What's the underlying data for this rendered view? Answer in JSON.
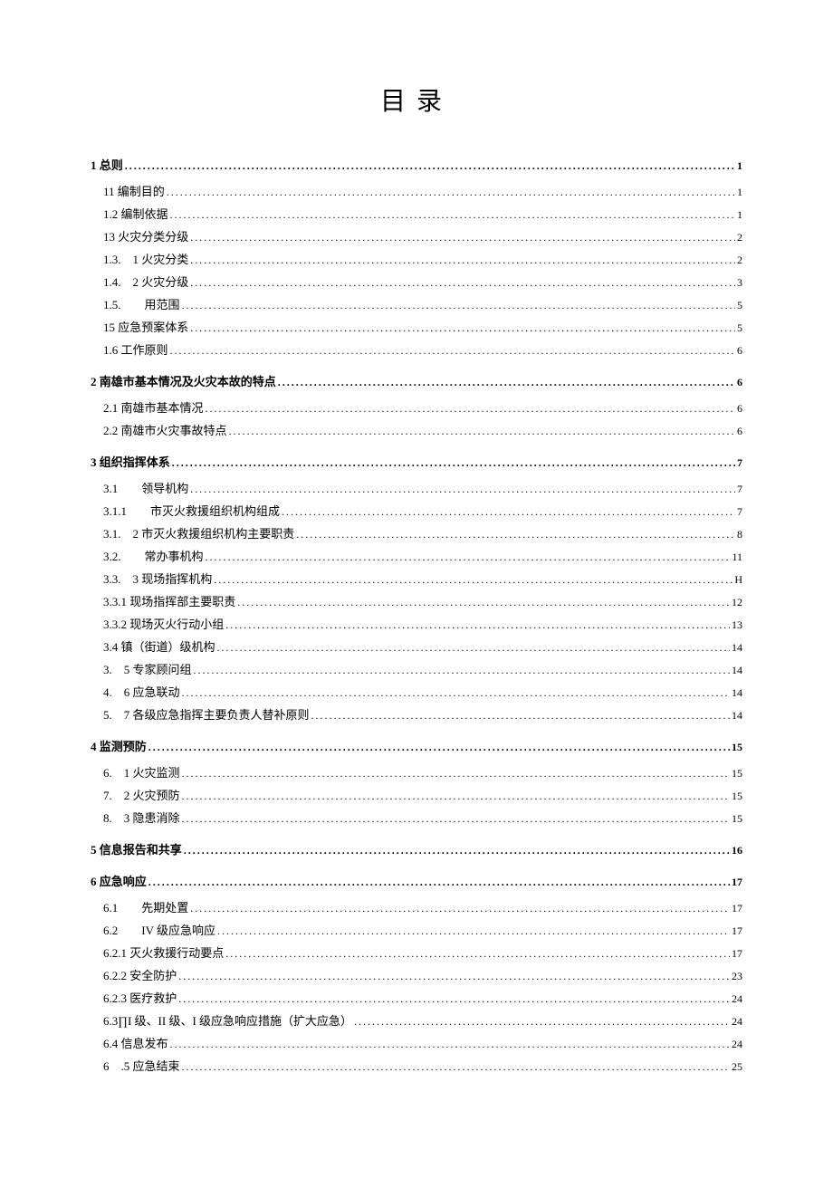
{
  "title": "目录",
  "toc": [
    {
      "label": "1 总则",
      "page": "1",
      "bold": true,
      "indent": 0,
      "gap": true
    },
    {
      "label": "11 编制目的",
      "page": "1",
      "bold": false,
      "indent": 1
    },
    {
      "label": "1.2 编制依据",
      "page": "1",
      "bold": false,
      "indent": 1
    },
    {
      "label": "13 火灾分类分级",
      "page": "2",
      "bold": false,
      "indent": 1
    },
    {
      "label": "1.3.　1 火灾分类",
      "page": "2",
      "bold": false,
      "indent": 2
    },
    {
      "label": "1.4.　2 火灾分级",
      "page": "3",
      "bold": false,
      "indent": 2
    },
    {
      "label": "1.5.　　用范围",
      "page": "5",
      "bold": false,
      "indent": 2
    },
    {
      "label": "15 应急预案体系",
      "page": "5",
      "bold": false,
      "indent": 1
    },
    {
      "label": "1.6 工作原则",
      "page": "6",
      "bold": false,
      "indent": 1
    },
    {
      "label": "2 南雄市基本情况及火灾本故的特点",
      "page": "6",
      "bold": true,
      "indent": 0,
      "gap": true
    },
    {
      "label": "2.1 南雄市基本情况",
      "page": "6",
      "bold": false,
      "indent": 1
    },
    {
      "label": "2.2 南雄市火灾事故特点",
      "page": "6",
      "bold": false,
      "indent": 1
    },
    {
      "label": "3 组织指挥体系",
      "page": "7",
      "bold": true,
      "indent": 0,
      "gap": true
    },
    {
      "label": "3.1　　领导机构",
      "page": "7",
      "bold": false,
      "indent": 1
    },
    {
      "label": "3.1.1　　市灭火救援组织机构组成",
      "page": "7",
      "bold": false,
      "indent": 1
    },
    {
      "label": "3.1.　2 市灭火救援组织机构主要职责",
      "page": "8",
      "bold": false,
      "indent": 1
    },
    {
      "label": "3.2.　　常办事机构",
      "page": "11",
      "bold": false,
      "indent": 1
    },
    {
      "label": "3.3.　3 现场指挥机构",
      "page": "H",
      "bold": false,
      "indent": 1
    },
    {
      "label": "3.3.1 现场指挥部主要职责",
      "page": "12",
      "bold": false,
      "indent": 1
    },
    {
      "label": "3.3.2 现场灭火行动小组",
      "page": "13",
      "bold": false,
      "indent": 1
    },
    {
      "label": "3.4 镇（街道）级机构",
      "page": "14",
      "bold": false,
      "indent": 1
    },
    {
      "label": "3.　5 专家顾问组",
      "page": "14",
      "bold": false,
      "indent": 1
    },
    {
      "label": "4.　6 应急联动",
      "page": "14",
      "bold": false,
      "indent": 1
    },
    {
      "label": "5.　7 各级应急指挥主要负责人替补原则",
      "page": "14",
      "bold": false,
      "indent": 1
    },
    {
      "label": "4 监测预防",
      "page": "15",
      "bold": true,
      "indent": 0,
      "gap": true
    },
    {
      "label": "6.　1 火灾监测",
      "page": "15",
      "bold": false,
      "indent": 1
    },
    {
      "label": "7.　2 火灾预防",
      "page": "15",
      "bold": false,
      "indent": 1
    },
    {
      "label": "8.　3 隐患消除",
      "page": "15",
      "bold": false,
      "indent": 1
    },
    {
      "label": "5 信息报告和共享",
      "page": "16",
      "bold": true,
      "indent": 0,
      "gap": true
    },
    {
      "label": "6 应急响应",
      "page": "17",
      "bold": true,
      "indent": 0,
      "gap": true
    },
    {
      "label": "6.1　　先期处置",
      "page": "17",
      "bold": false,
      "indent": 1
    },
    {
      "label": "6.2　　IV 级应急响应",
      "page": "17",
      "bold": false,
      "indent": 1
    },
    {
      "label": "6.2.1 灭火救援行动要点",
      "page": "17",
      "bold": false,
      "indent": 1
    },
    {
      "label": "6.2.2 安全防护",
      "page": "23",
      "bold": false,
      "indent": 1
    },
    {
      "label": "6.2.3 医疗救护",
      "page": "24",
      "bold": false,
      "indent": 1
    },
    {
      "label": "6.3∏I 级、II 级、I 级应急响应措施（扩大应急）",
      "page": "24",
      "bold": false,
      "indent": 1
    },
    {
      "label": "6.4 信息发布",
      "page": "24",
      "bold": false,
      "indent": 1
    },
    {
      "label": "6　.5 应急结束",
      "page": "25",
      "bold": false,
      "indent": 1
    }
  ]
}
